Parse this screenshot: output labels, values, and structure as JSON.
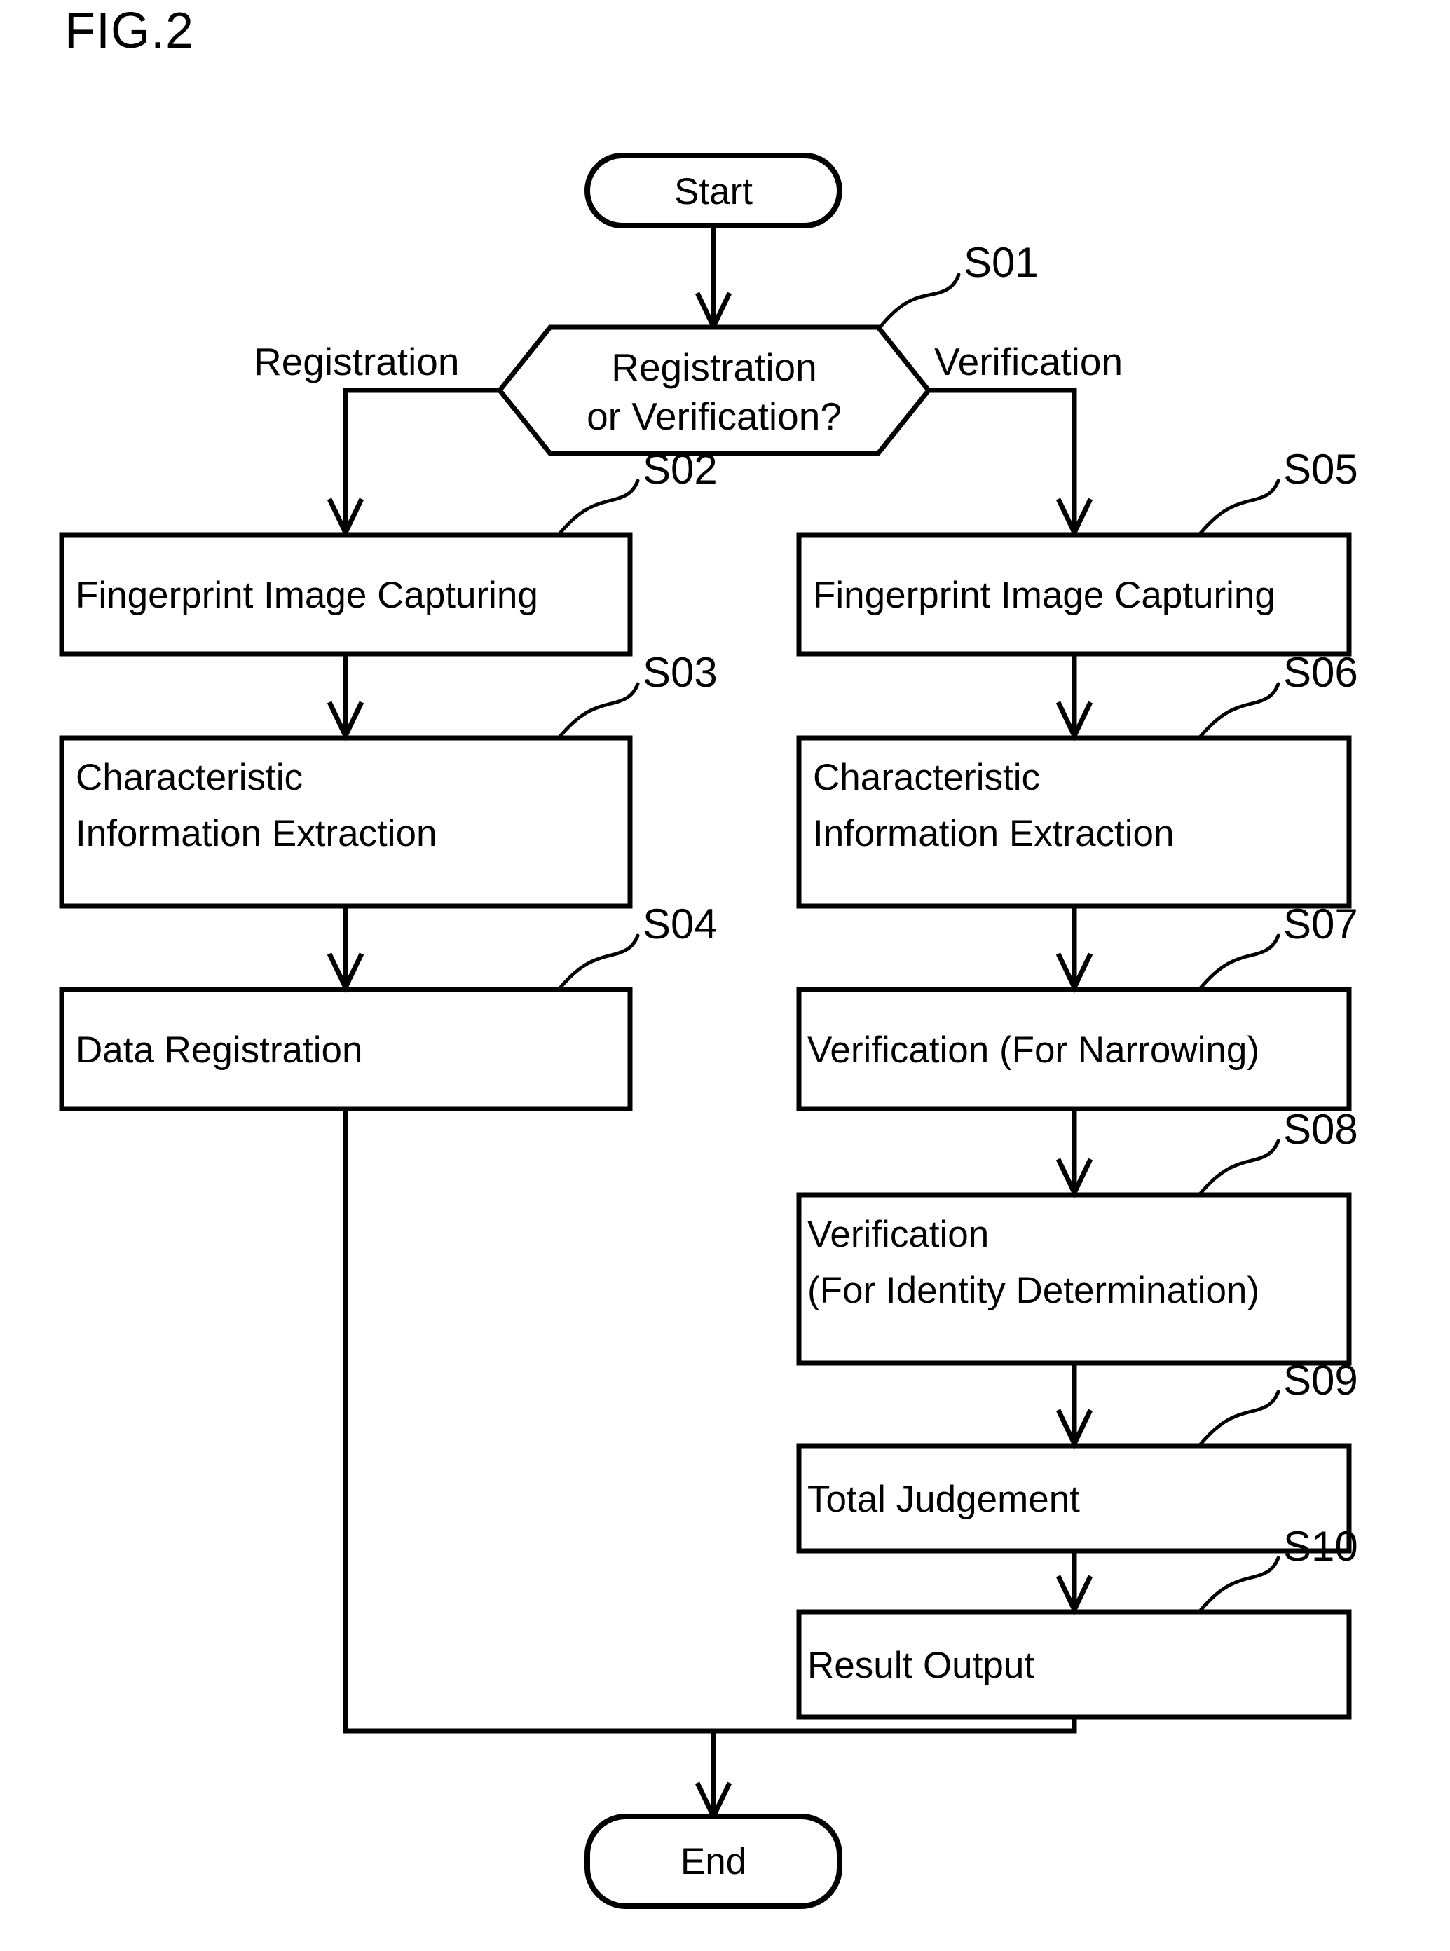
{
  "figure": {
    "title": "FIG.2",
    "type": "flowchart"
  },
  "terminators": {
    "start": "Start",
    "end": "End"
  },
  "decision": {
    "step": "S01",
    "line1": "Registration",
    "line2": "or Verification?",
    "branch_left": "Registration",
    "branch_right": "Verification"
  },
  "left_branch": [
    {
      "step": "S02",
      "line1": "Fingerprint Image Capturing",
      "line2": ""
    },
    {
      "step": "S03",
      "line1": "Characteristic",
      "line2": "Information Extraction"
    },
    {
      "step": "S04",
      "line1": "Data Registration",
      "line2": ""
    }
  ],
  "right_branch": [
    {
      "step": "S05",
      "line1": "Fingerprint Image Capturing",
      "line2": ""
    },
    {
      "step": "S06",
      "line1": "Characteristic",
      "line2": "Information Extraction"
    },
    {
      "step": "S07",
      "line1": "Verification (For Narrowing)",
      "line2": ""
    },
    {
      "step": "S08",
      "line1": "Verification",
      "line2": "(For Identity Determination)"
    },
    {
      "step": "S09",
      "line1": "Total Judgement",
      "line2": ""
    },
    {
      "step": "S10",
      "line1": "Result Output",
      "line2": ""
    }
  ],
  "colors": {
    "stroke": "#000000",
    "fill": "#ffffff",
    "text": "#000000"
  }
}
